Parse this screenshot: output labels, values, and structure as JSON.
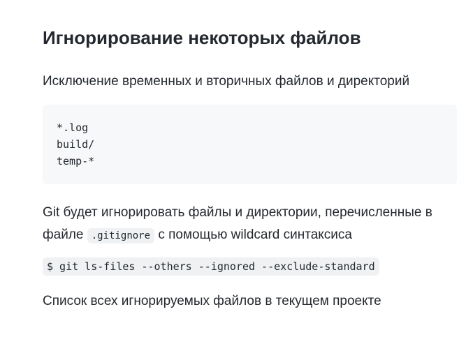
{
  "section": {
    "title": "Игнорирование некоторых файлов",
    "intro": "Исключение временных и вторичных файлов и директорий",
    "code_lines": [
      "*.log",
      "build/",
      "temp-*"
    ],
    "para_before": "Git будет игнорировать файлы и директории, перечисленные в файле ",
    "inline_code": ".gitignore",
    "para_after": " с помощью wildcard синтаксиса",
    "command": "$ git ls-files --others --ignored --exclude-standard",
    "command_desc": "Список всех игнорируемых файлов в текущем проекте"
  }
}
